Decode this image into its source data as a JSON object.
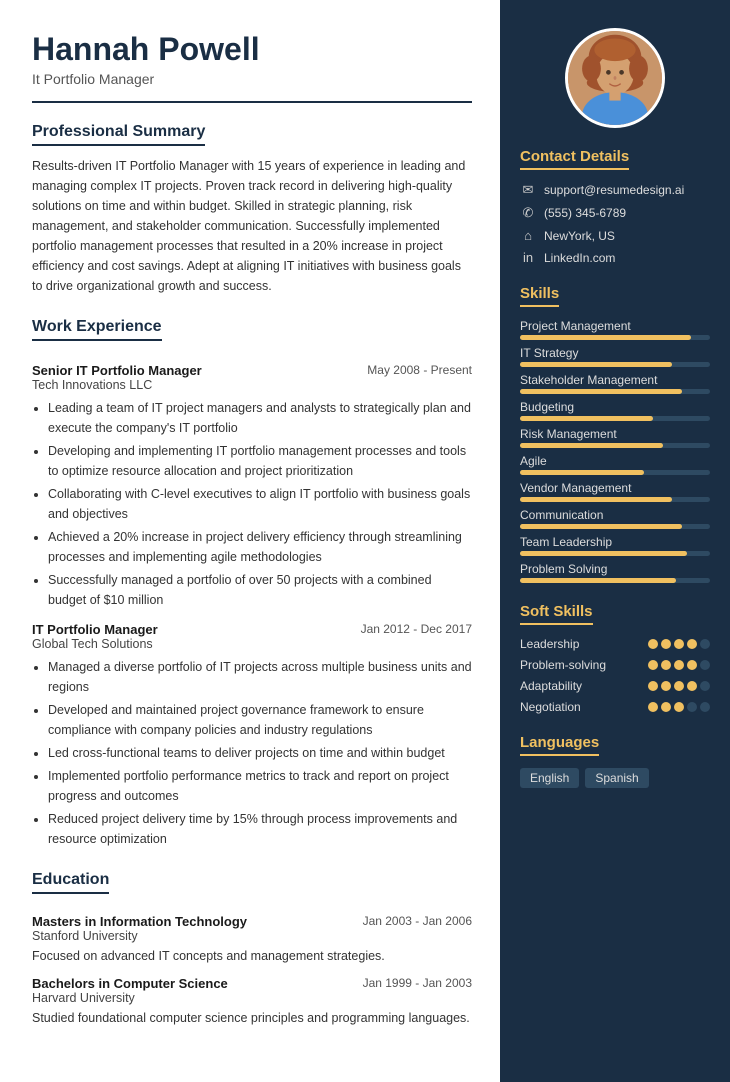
{
  "header": {
    "name": "Hannah Powell",
    "title": "It Portfolio Manager"
  },
  "summary": {
    "section_title": "Professional Summary",
    "text": "Results-driven IT Portfolio Manager with 15 years of experience in leading and managing complex IT projects. Proven track record in delivering high-quality solutions on time and within budget. Skilled in strategic planning, risk management, and stakeholder communication. Successfully implemented portfolio management processes that resulted in a 20% increase in project efficiency and cost savings. Adept at aligning IT initiatives with business goals to drive organizational growth and success."
  },
  "work_experience": {
    "section_title": "Work Experience",
    "jobs": [
      {
        "title": "Senior IT Portfolio Manager",
        "date": "May 2008 - Present",
        "company": "Tech Innovations LLC",
        "bullets": [
          "Leading a team of IT project managers and analysts to strategically plan and execute the company's IT portfolio",
          "Developing and implementing IT portfolio management processes and tools to optimize resource allocation and project prioritization",
          "Collaborating with C-level executives to align IT portfolio with business goals and objectives",
          "Achieved a 20% increase in project delivery efficiency through streamlining processes and implementing agile methodologies",
          "Successfully managed a portfolio of over 50 projects with a combined budget of $10 million"
        ]
      },
      {
        "title": "IT Portfolio Manager",
        "date": "Jan 2012 - Dec 2017",
        "company": "Global Tech Solutions",
        "bullets": [
          "Managed a diverse portfolio of IT projects across multiple business units and regions",
          "Developed and maintained project governance framework to ensure compliance with company policies and industry regulations",
          "Led cross-functional teams to deliver projects on time and within budget",
          "Implemented portfolio performance metrics to track and report on project progress and outcomes",
          "Reduced project delivery time by 15% through process improvements and resource optimization"
        ]
      }
    ]
  },
  "education": {
    "section_title": "Education",
    "items": [
      {
        "degree": "Masters in Information Technology",
        "date": "Jan 2003 - Jan 2006",
        "school": "Stanford University",
        "desc": "Focused on advanced IT concepts and management strategies."
      },
      {
        "degree": "Bachelors in Computer Science",
        "date": "Jan 1999 - Jan 2003",
        "school": "Harvard University",
        "desc": "Studied foundational computer science principles and programming languages."
      }
    ]
  },
  "contact": {
    "section_title": "Contact Details",
    "items": [
      {
        "icon": "✉",
        "text": "support@resumedesign.ai"
      },
      {
        "icon": "✆",
        "text": "(555) 345-6789"
      },
      {
        "icon": "⌂",
        "text": "NewYork, US"
      },
      {
        "icon": "in",
        "text": "LinkedIn.com"
      }
    ]
  },
  "skills": {
    "section_title": "Skills",
    "items": [
      {
        "name": "Project Management",
        "pct": 90
      },
      {
        "name": "IT Strategy",
        "pct": 80
      },
      {
        "name": "Stakeholder Management",
        "pct": 85
      },
      {
        "name": "Budgeting",
        "pct": 70
      },
      {
        "name": "Risk Management",
        "pct": 75
      },
      {
        "name": "Agile",
        "pct": 65
      },
      {
        "name": "Vendor Management",
        "pct": 80
      },
      {
        "name": "Communication",
        "pct": 85
      },
      {
        "name": "Team Leadership",
        "pct": 88
      },
      {
        "name": "Problem Solving",
        "pct": 82
      }
    ]
  },
  "soft_skills": {
    "section_title": "Soft Skills",
    "items": [
      {
        "name": "Leadership",
        "filled": 4,
        "total": 5
      },
      {
        "name": "Problem-solving",
        "filled": 4,
        "total": 5
      },
      {
        "name": "Adaptability",
        "filled": 4,
        "total": 5
      },
      {
        "name": "Negotiation",
        "filled": 3,
        "total": 5
      }
    ]
  },
  "languages": {
    "section_title": "Languages",
    "items": [
      "English",
      "Spanish"
    ]
  }
}
